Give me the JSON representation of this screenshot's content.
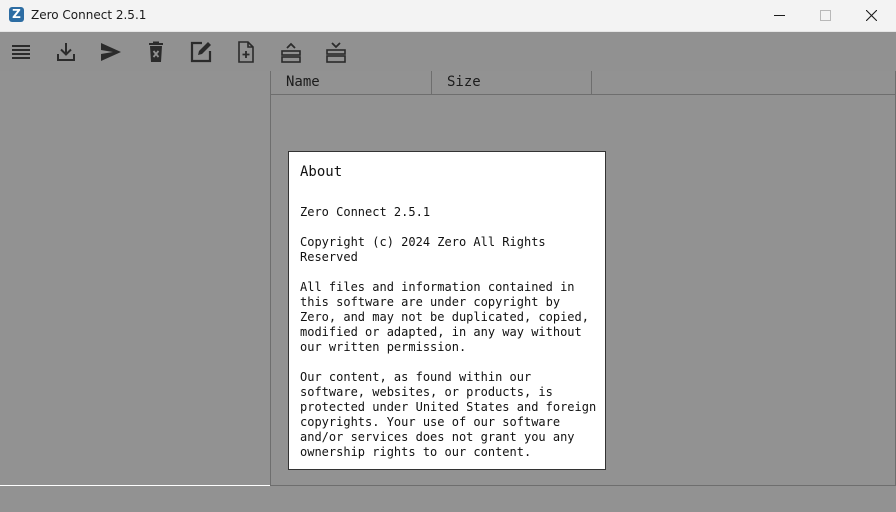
{
  "window": {
    "title": "Zero Connect 2.5.1",
    "app_icon_letter": "Z"
  },
  "toolbar": {
    "icons": [
      "menu-icon",
      "download-icon",
      "send-icon",
      "delete-icon",
      "edit-icon",
      "new-file-icon",
      "upload-stack-icon",
      "download-stack-icon"
    ]
  },
  "file_list": {
    "columns": [
      "Name",
      "Size"
    ]
  },
  "about_dialog": {
    "title": "About",
    "version": "Zero Connect 2.5.1",
    "copyright": "Copyright (c) 2024 Zero All Rights Reserved",
    "paragraph1": "All files and information contained in this software are under copyright by Zero, and may not be duplicated, copied, modified or adapted, in any way without our written permission.",
    "paragraph2": "Our content, as found within our software, websites, or products, is protected under United States and foreign copyrights. Your use of our software and/or services does not grant you any ownership rights to our content."
  },
  "colors": {
    "pane_background": "#929292",
    "titlebar": "#f3f3f3",
    "app_icon": "#2d6da3"
  }
}
